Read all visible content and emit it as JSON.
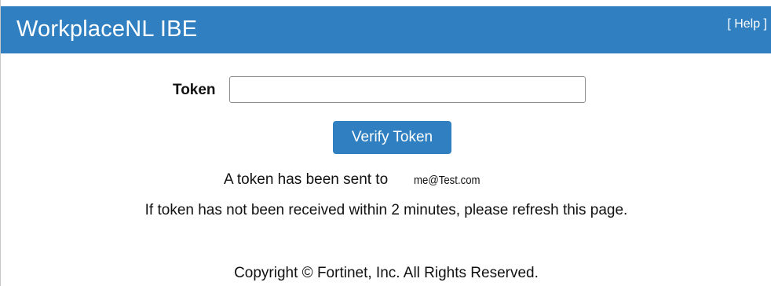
{
  "header": {
    "title": "WorkplaceNL IBE",
    "help_link": "[ Help ]"
  },
  "form": {
    "token_label": "Token",
    "token_value": "",
    "verify_button": "Verify Token"
  },
  "messages": {
    "sent_prefix": "A token has been sent to",
    "sent_email": "me@Test.com",
    "refresh_note": "If token has not been received within 2 minutes, please refresh this page."
  },
  "footer": {
    "copyright": "Copyright © Fortinet, Inc. All Rights Reserved."
  },
  "colors": {
    "header_bg": "#2f7fc1",
    "button_bg": "#2f7fc1"
  }
}
